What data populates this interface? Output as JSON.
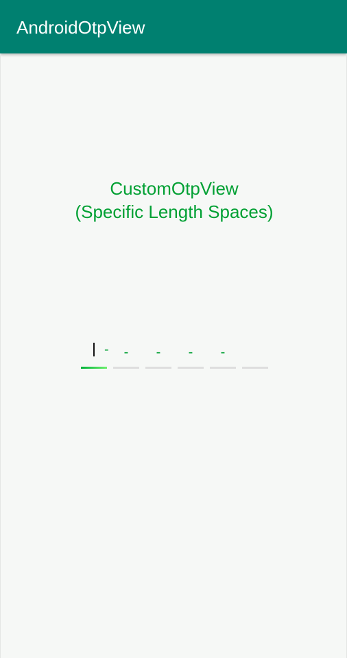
{
  "app": {
    "title": "AndroidOtpView",
    "colors": {
      "app_bar": "#008070",
      "accent": "#00a033",
      "background": "#f6f8f6",
      "otp_inactive_line": "#dedede"
    }
  },
  "main": {
    "heading_line1": "CustomOtpView",
    "heading_line2": "(Specific Length Spaces)"
  },
  "otp": {
    "length": 6,
    "value": "",
    "placeholder_char": "-",
    "active_index": 0
  }
}
